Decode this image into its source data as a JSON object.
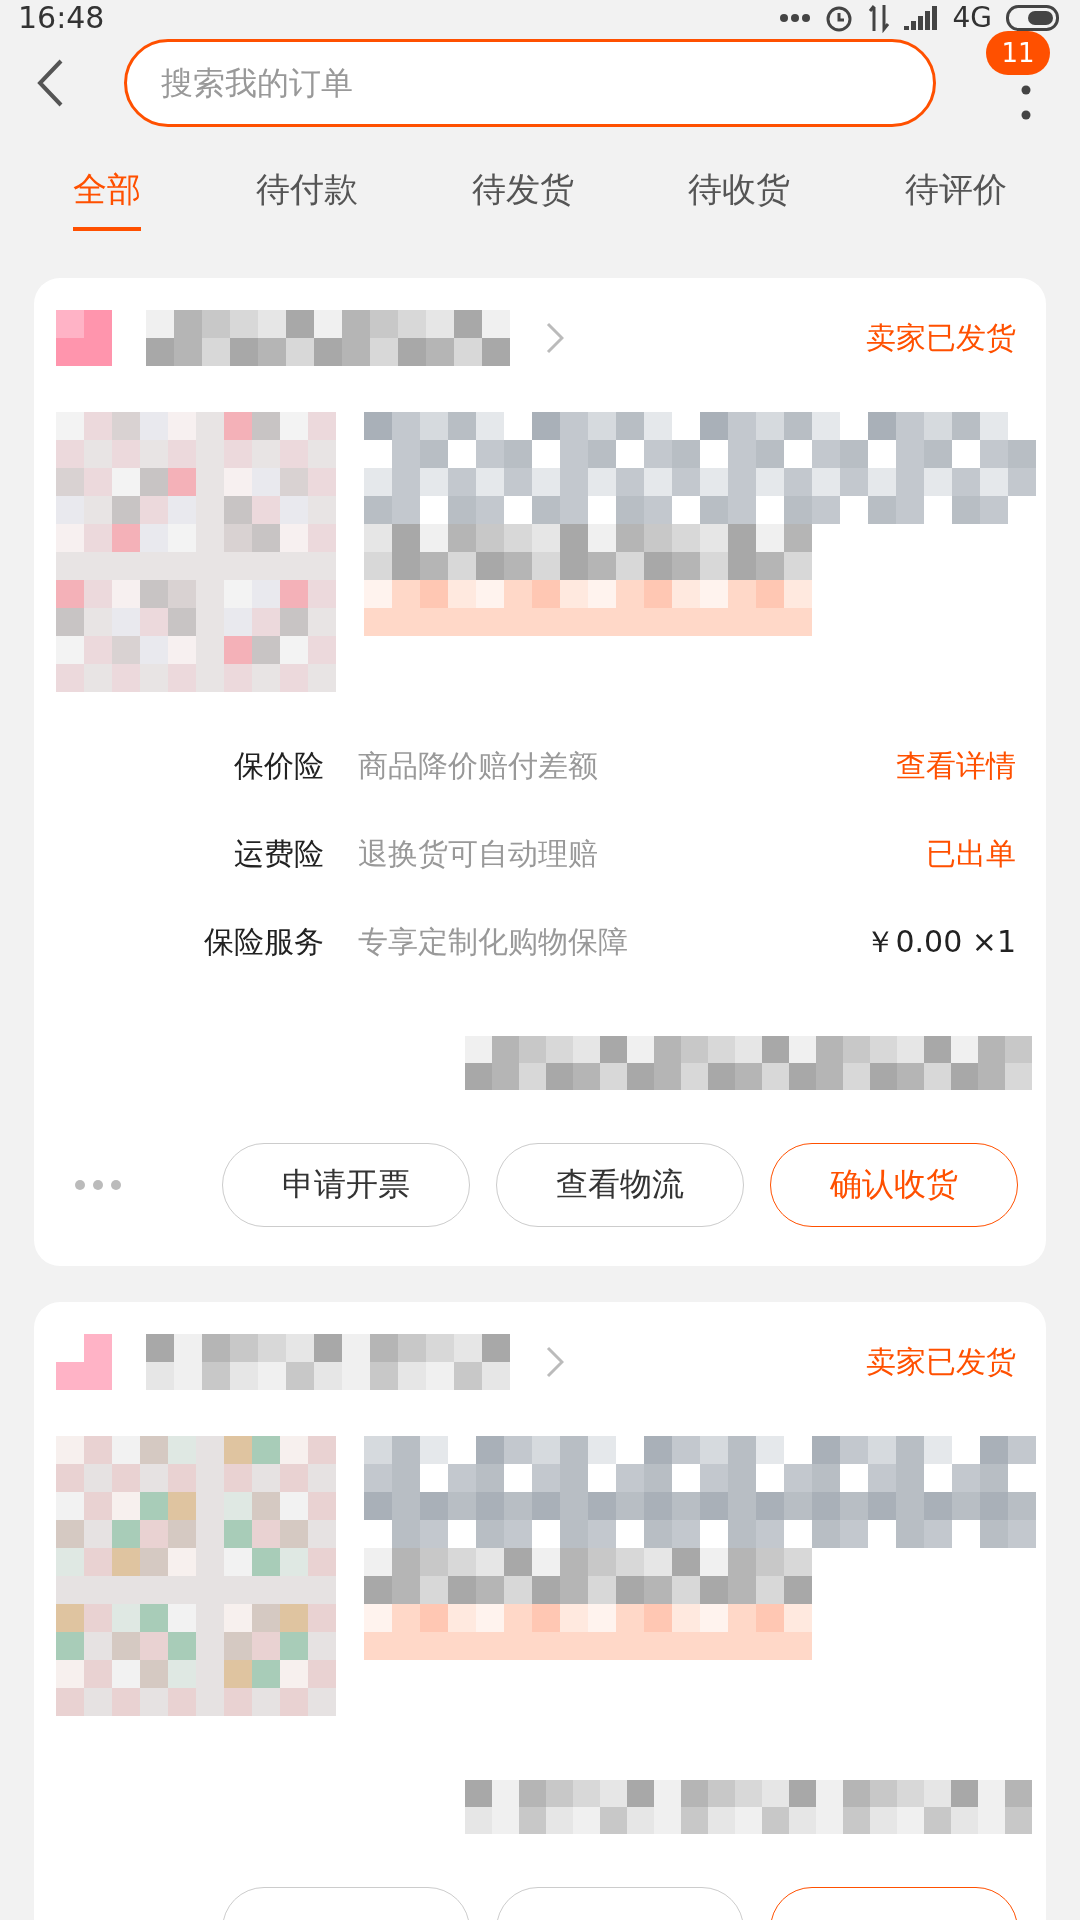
{
  "status_bar": {
    "time": "16:48",
    "network": "4G"
  },
  "header": {
    "search": {
      "placeholder": "搜索我的订单"
    },
    "badge": "11"
  },
  "tabs": [
    {
      "label": "全部",
      "selected": true
    },
    {
      "label": "待付款",
      "selected": false
    },
    {
      "label": "待发货",
      "selected": false
    },
    {
      "label": "待收货",
      "selected": false
    },
    {
      "label": "待评价",
      "selected": false
    }
  ],
  "orders": [
    {
      "status": "卖家已发货",
      "more_actions": true,
      "services": [
        {
          "label": "保价险",
          "description": "商品降价赔付差额",
          "value": "查看详情",
          "kind": "link"
        },
        {
          "label": "运费险",
          "description": "退换货可自动理赔",
          "value": "已出单",
          "kind": "link"
        },
        {
          "label": "保险服务",
          "description": "专享定制化购物保障",
          "value": "￥0.00 ×1",
          "kind": "price"
        }
      ],
      "buttons": [
        {
          "label": "申请开票",
          "primary": false
        },
        {
          "label": "查看物流",
          "primary": false
        },
        {
          "label": "确认收货",
          "primary": true
        }
      ]
    },
    {
      "status": "卖家已发货",
      "buttons": [
        {
          "primary": false
        },
        {
          "primary": false
        },
        {
          "primary": true
        }
      ]
    }
  ]
}
